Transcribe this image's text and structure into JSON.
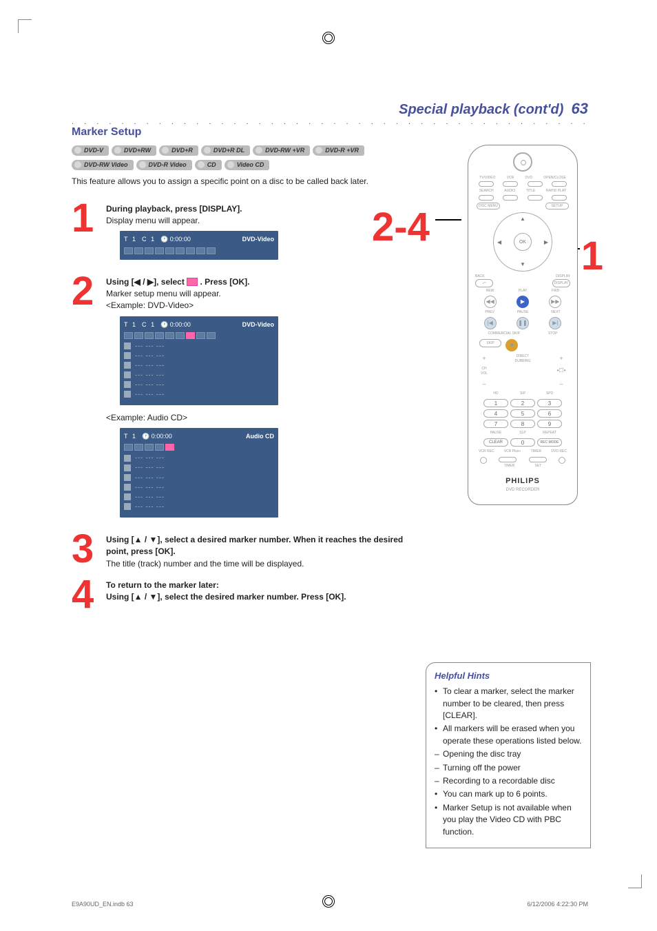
{
  "page": {
    "title_prefix": "Special playback (cont'd)",
    "page_number": "63",
    "section_heading": "Marker Setup",
    "intro": "This feature allows you to assign a specific point on a disc to be called back later."
  },
  "badges_row1": [
    "DVD-V",
    "DVD+RW",
    "DVD+R",
    "DVD+R DL",
    "DVD-RW +VR",
    "DVD-R +VR"
  ],
  "badges_row2": [
    "DVD-RW Video",
    "DVD-R Video",
    "CD",
    "Video CD"
  ],
  "overlay": {
    "range": "2-4",
    "one": "1"
  },
  "steps": {
    "s1": {
      "num": "1",
      "bold": "During playback, press [DISPLAY].",
      "text": "Display menu will appear.",
      "osd": {
        "t": "T",
        "tval": "1",
        "c": "C",
        "cval": "1",
        "time": "0:00:00",
        "mode": "DVD-Video"
      }
    },
    "s2": {
      "num": "2",
      "bold_pre": "Using [◀ / ▶], select ",
      "bold_post": " . Press [OK].",
      "text": "Marker setup menu will appear.",
      "example1": "<Example: DVD-Video>",
      "osd1": {
        "t": "T",
        "tval": "1",
        "c": "C",
        "cval": "1",
        "time": "0:00:00",
        "mode": "DVD-Video"
      },
      "example2": "<Example: Audio CD>",
      "osd2": {
        "t": "T",
        "tval": "1",
        "time": "0:00:00",
        "mode": "Audio CD"
      },
      "marker_placeholder": "--- --- ---"
    },
    "s3": {
      "num": "3",
      "bold": "Using [▲ / ▼], select a desired marker number.  When it reaches the desired point, press [OK].",
      "text": "The title (track) number and the time will be displayed."
    },
    "s4": {
      "num": "4",
      "bold1": "To return to the marker later:",
      "bold2": "Using [▲ / ▼], select the desired marker number. Press [OK]."
    }
  },
  "remote": {
    "row1_labels": [
      "TV/VIDEO",
      "VCR",
      "DVD",
      "OPEN/CLOSE"
    ],
    "row2_labels": [
      "SEARCH",
      "AUDIO",
      "TITLE",
      "RAPID PLAY"
    ],
    "disc_menu": "DISC MENU",
    "setup": "SETUP",
    "ok": "OK",
    "back": "BACK",
    "display": "DISPLAY",
    "rew": "REW",
    "play": "PLAY",
    "fwd": "FWD",
    "prev": "PREV",
    "pause": "PAUSE",
    "next": "NEXT",
    "com_skip": "COMMERCIAL SKIP",
    "stop": "STOP",
    "ch_vol_plus": "+",
    "ch_vol_minus": "–",
    "ch_label": "CH VOL",
    "direct_label1": "DIRECT",
    "direct_label2": "DUBBING",
    "hd": "HD",
    "sip": "SIP",
    "spd": "SPD",
    "bot_sub": [
      "PAUSE",
      "SLP",
      "REPEAT"
    ],
    "nums": [
      "1",
      "2",
      "3",
      "4",
      "5",
      "6",
      "7",
      "8",
      "9"
    ],
    "clear": "CLEAR",
    "zero": "0",
    "recmode": "REC MODE",
    "sub2": [
      "VCR REC",
      "VCR Plus+",
      "TIMER",
      "DVD REC"
    ],
    "sub3": [
      "",
      "TIMER",
      "SET",
      ""
    ],
    "brand": "PHILIPS",
    "sub_brand": "DVD RECORDER"
  },
  "hints": {
    "title": "Helpful Hints",
    "items": [
      {
        "type": "bul",
        "text": "To clear a marker, select the marker number to be cleared, then press [CLEAR]."
      },
      {
        "type": "bul",
        "text": "All markers will be erased when you operate these operations listed below."
      },
      {
        "type": "dash",
        "text": "Opening the disc tray"
      },
      {
        "type": "dash",
        "text": "Turning off the power"
      },
      {
        "type": "dash",
        "text": "Recording to a recordable disc"
      },
      {
        "type": "bul",
        "text": "You can mark up to 6 points."
      },
      {
        "type": "bul",
        "text": "Marker Setup is not available when you play the Video CD with PBC function."
      }
    ]
  },
  "footer": {
    "left": "E9A90UD_EN.indb   63",
    "right": "6/12/2006   4:22:30 PM"
  }
}
